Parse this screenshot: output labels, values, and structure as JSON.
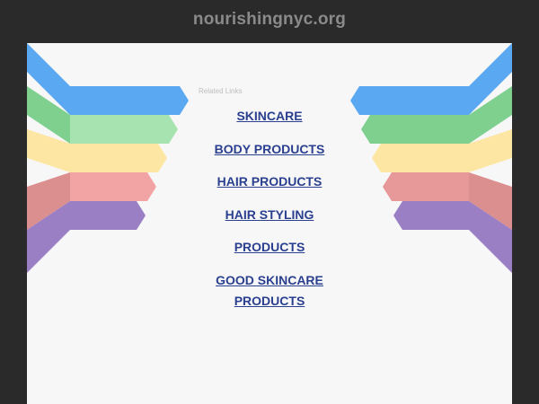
{
  "header": {
    "site_title": "nourishingnyc.org"
  },
  "main": {
    "related_label": "Related Links",
    "links": [
      "SKINCARE",
      "BODY PRODUCTS",
      "HAIR PRODUCTS",
      "HAIR STYLING",
      "PRODUCTS",
      "GOOD SKINCARE PRODUCTS"
    ]
  },
  "colors": {
    "background": "#2a2a2a",
    "panel": "#f7f7f7",
    "link": "#2a3f8f",
    "ribbon_blue": "#5aa8f2",
    "ribbon_green": "#7fd08f",
    "ribbon_yellow": "#fde6a4",
    "ribbon_red": "#f2a4a4",
    "ribbon_purple": "#9a7fc5"
  }
}
